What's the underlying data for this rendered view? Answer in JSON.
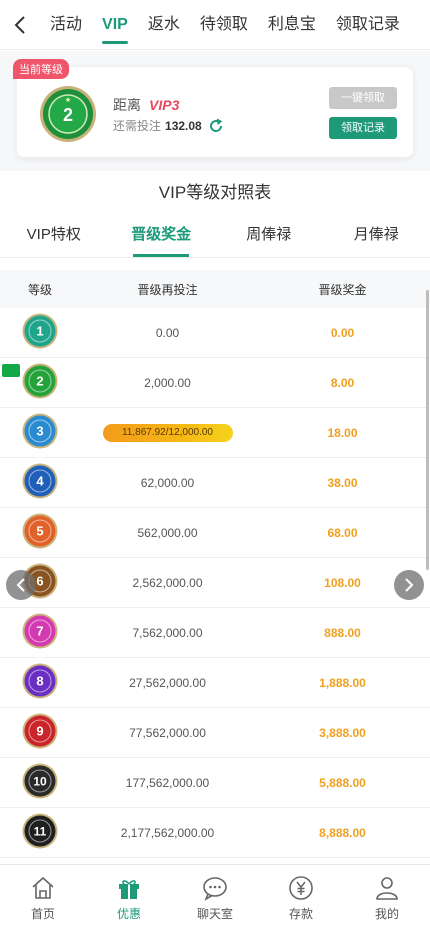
{
  "top_tabs": [
    "活动",
    "VIP",
    "返水",
    "待领取",
    "利息宝",
    "领取记录"
  ],
  "active_top_tab": "VIP",
  "card": {
    "current_tag": "当前等级",
    "badge_level": "2",
    "distance_label": "距离",
    "next_level": "VIP3",
    "need_label": "还需投注",
    "need_value": "132.08",
    "btn_onekey": "一键领取",
    "btn_record": "领取记录"
  },
  "section_title": "VIP等级对照表",
  "sub_tabs": [
    "VIP特权",
    "晋级奖金",
    "周俸禄",
    "月俸禄"
  ],
  "table": {
    "headers": [
      "等级",
      "晋级再投注",
      "晋级奖金"
    ],
    "rows": [
      {
        "level": "1",
        "bet": "0.00",
        "bonus": "0.00",
        "color": "#1fa58a"
      },
      {
        "level": "2",
        "bet": "2,000.00",
        "bonus": "8.00",
        "color": "#23a33a"
      },
      {
        "level": "3",
        "bet": "11,867.92/12,000.00",
        "bonus": "18.00",
        "color": "#2a8bd1"
      },
      {
        "level": "4",
        "bet": "62,000.00",
        "bonus": "38.00",
        "color": "#1f5fb8"
      },
      {
        "level": "5",
        "bet": "562,000.00",
        "bonus": "68.00",
        "color": "#e0622a"
      },
      {
        "level": "6",
        "bet": "2,562,000.00",
        "bonus": "108.00",
        "color": "#8a5420"
      },
      {
        "level": "7",
        "bet": "7,562,000.00",
        "bonus": "888.00",
        "color": "#d33ab0"
      },
      {
        "level": "8",
        "bet": "27,562,000.00",
        "bonus": "1,888.00",
        "color": "#6a2fc2"
      },
      {
        "level": "9",
        "bet": "77,562,000.00",
        "bonus": "3,888.00",
        "color": "#c9252a"
      },
      {
        "level": "10",
        "bet": "177,562,000.00",
        "bonus": "5,888.00",
        "color": "#2a2a2a"
      },
      {
        "level": "11",
        "bet": "2,177,562,000.00",
        "bonus": "8,888.00",
        "color": "#1f1f1f"
      }
    ]
  },
  "bottom_nav": [
    "首页",
    "优惠",
    "聊天室",
    "存款",
    "我的"
  ],
  "active_bottom": "优惠"
}
